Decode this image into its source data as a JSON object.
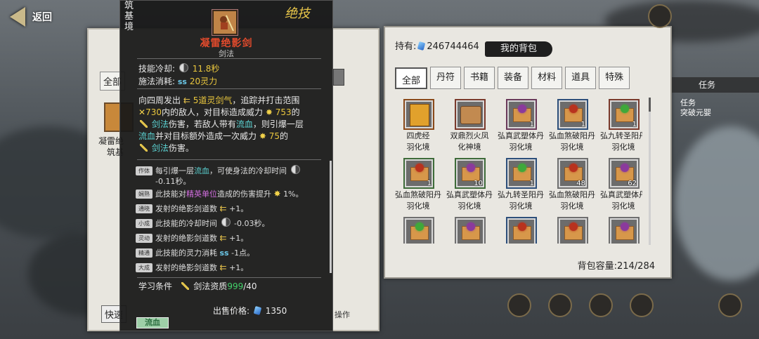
{
  "nav": {
    "back_label": "返回"
  },
  "left_panel": {
    "tab_label": "全部",
    "item_name": "凝雷绝",
    "item_realm": "筑基",
    "quick_label": "快速",
    "op_label": "操作"
  },
  "tooltip": {
    "realm": "筑基境",
    "seal": "绝技",
    "name": "凝雷绝影剑",
    "type": "剑法",
    "cooldown_label": "技能冷却:",
    "cooldown_value": "11.8秒",
    "cost_label": "施法消耗:",
    "cost_value": "20灵力",
    "desc": {
      "p1": "向四周发出",
      "count": "5道灵剑气",
      "p2": "，追踪并打击范围",
      "range": "730",
      "p3": "内的敌人，对目标造成威力",
      "power": "753",
      "p4": "的",
      "sword1": "剑法",
      "p5": "伤害，若敌人带有",
      "bleed": "流血",
      "p6": "，则引爆一层",
      "bleed2": "流血",
      "p7": "并对目标额外造成一次威力",
      "extra": "75",
      "p8": "的",
      "sword2": "剑法",
      "p9": "伤害。"
    },
    "traits": [
      {
        "tag": "作体",
        "pre": "每引爆一层",
        "hl": "流血",
        "post": "，可使身法的冷却时间",
        "val": "-0.11秒。"
      },
      {
        "tag": "娴熟",
        "pre": "此技能对",
        "hl": "精英单位",
        "post": "造成的伤害提升",
        "val": "1%。"
      },
      {
        "tag": "通晓",
        "pre": "发射的绝影剑道数",
        "val": "+1。"
      },
      {
        "tag": "小成",
        "pre": "此技能的冷却时间",
        "val": "-0.03秒。"
      },
      {
        "tag": "灵动",
        "pre": "发射的绝影剑道数",
        "val": "+1。"
      },
      {
        "tag": "精通",
        "pre": "此技能的灵力消耗",
        "val": "-1点。"
      },
      {
        "tag": "大成",
        "pre": "发射的绝影剑道数",
        "val": "+1。"
      }
    ],
    "learn_label": "学习条件",
    "learn_req": "剑法资质",
    "learn_have": "999",
    "learn_need": "/40",
    "sell_label": "出售价格:",
    "sell_value": "1350",
    "bleed_button": "流血"
  },
  "bag": {
    "holding_label": "持有:",
    "holding_value": "246744464",
    "title": "我的背包",
    "tabs": [
      "全部",
      "丹符",
      "书籍",
      "装备",
      "材料",
      "道具",
      "特殊"
    ],
    "items": [
      {
        "name": "四虎经",
        "realm": "羽化境",
        "icon": "book",
        "frame": "orange",
        "count": ""
      },
      {
        "name": "双鼎烈火凤",
        "realm": "化神境",
        "icon": "scroll",
        "frame": "red",
        "count": ""
      },
      {
        "name": "弘真武塑体丹",
        "realm": "羽化境",
        "icon": "pill",
        "frame": "pink",
        "color": "#8b3a9c",
        "count": "1"
      },
      {
        "name": "弘血煞破阳丹",
        "realm": "羽化境",
        "icon": "pill",
        "frame": "blue",
        "color": "#b8321e",
        "count": "1"
      },
      {
        "name": "弘九转圣阳丹",
        "realm": "羽化境",
        "icon": "pill",
        "frame": "red",
        "color": "#3fa83a",
        "count": "1"
      },
      {
        "name": "弘血煞破阳丹",
        "realm": "羽化境",
        "icon": "pill",
        "frame": "green",
        "color": "#b8321e",
        "count": "1"
      },
      {
        "name": "弘真武塑体丹",
        "realm": "羽化境",
        "icon": "pill",
        "frame": "green",
        "color": "#8b3a9c",
        "count": "10"
      },
      {
        "name": "弘九转圣阳丹",
        "realm": "羽化境",
        "icon": "pill",
        "frame": "blue",
        "color": "#3fa83a",
        "count": "1"
      },
      {
        "name": "弘血煞破阳丹",
        "realm": "羽化境",
        "icon": "pill",
        "frame": "",
        "color": "#b8321e",
        "count": "48"
      },
      {
        "name": "弘真武塑体丹",
        "realm": "羽化境",
        "icon": "pill",
        "frame": "",
        "color": "#8b3a9c",
        "count": "62"
      },
      {
        "name": "",
        "realm": "",
        "icon": "pill",
        "frame": "",
        "color": "#3fa83a",
        "count": ""
      },
      {
        "name": "",
        "realm": "",
        "icon": "pill",
        "frame": "",
        "color": "#8b3a9c",
        "count": ""
      },
      {
        "name": "",
        "realm": "",
        "icon": "pill",
        "frame": "blue",
        "color": "#b8321e",
        "count": ""
      },
      {
        "name": "",
        "realm": "",
        "icon": "pill",
        "frame": "",
        "color": "#b8321e",
        "count": ""
      },
      {
        "name": "",
        "realm": "",
        "icon": "pill",
        "frame": "",
        "color": "#8b3a9c",
        "count": ""
      }
    ],
    "capacity_label": "背包容量:",
    "capacity_value": "214/284"
  },
  "right": {
    "tab_label": "任务",
    "text1": "任务",
    "text2": "突破元婴"
  }
}
